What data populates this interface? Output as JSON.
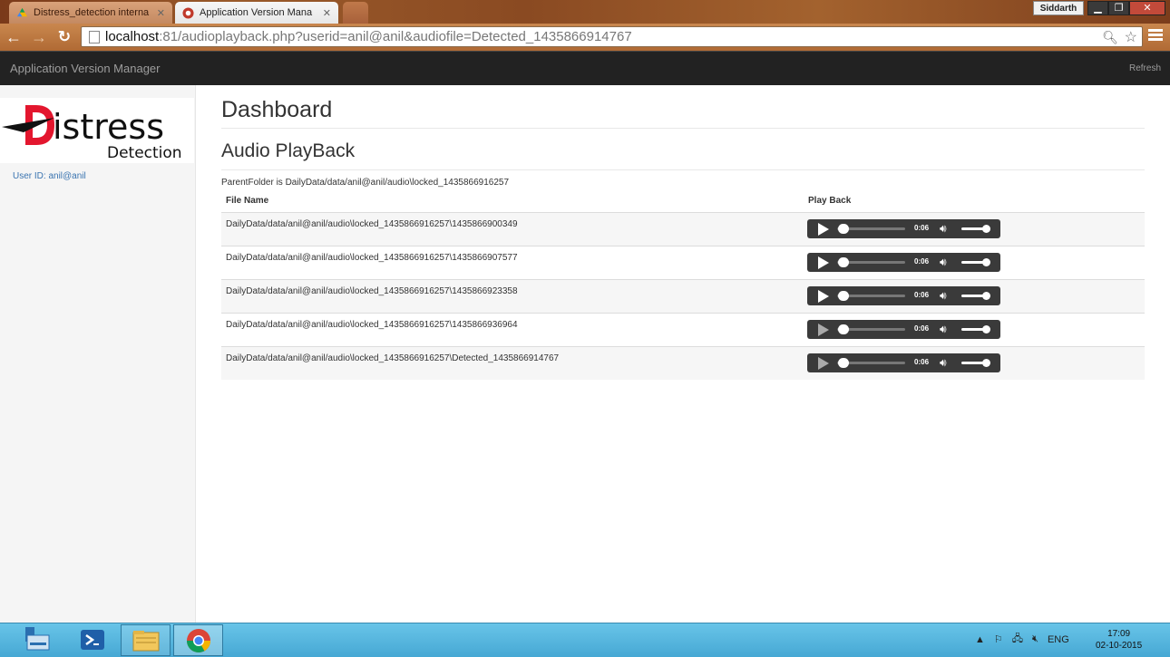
{
  "browser": {
    "tabs": [
      {
        "label": "Distress_detection interna",
        "active": false
      },
      {
        "label": "Application Version Mana",
        "active": true
      }
    ],
    "user_profile": "Siddarth",
    "url_host": "localhost",
    "url_rest": ":81/audioplayback.php?userid=anil@anil&audiofile=Detected_1435866914767"
  },
  "navbar": {
    "brand": "Application Version Manager",
    "refresh": "Refresh"
  },
  "sidebar": {
    "logo_text": "Distress",
    "logo_subtext": "Detection",
    "user_id": "User ID: anil@anil"
  },
  "main": {
    "title": "Dashboard",
    "section_title": "Audio PlayBack",
    "parent_folder": "ParentFolder is DailyData/data/anil@anil/audio\\locked_1435866916257",
    "columns": {
      "file_name": "File Name",
      "play_back": "Play Back"
    },
    "rows": [
      {
        "file": "DailyData/data/anil@anil/audio\\locked_1435866916257\\1435866900349",
        "time": "0:06"
      },
      {
        "file": "DailyData/data/anil@anil/audio\\locked_1435866916257\\1435866907577",
        "time": "0:06"
      },
      {
        "file": "DailyData/data/anil@anil/audio\\locked_1435866916257\\1435866923358",
        "time": "0:06"
      },
      {
        "file": "DailyData/data/anil@anil/audio\\locked_1435866916257\\1435866936964",
        "time": "0:06"
      },
      {
        "file": "DailyData/data/anil@anil/audio\\locked_1435866916257\\Detected_1435866914767",
        "time": "0:06"
      }
    ]
  },
  "taskbar": {
    "lang": "ENG",
    "time": "17:09",
    "date": "02-10-2015"
  },
  "colors": {
    "navbar_bg": "#222222",
    "logo_accent": "#e3162e",
    "link": "#3a74b0",
    "taskbar": "#56b4de"
  }
}
